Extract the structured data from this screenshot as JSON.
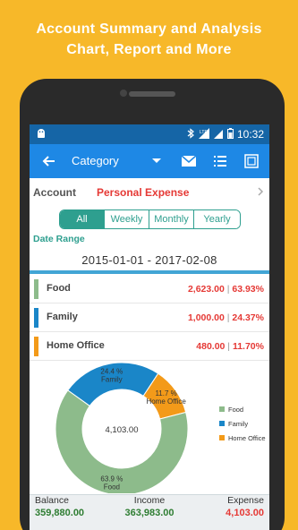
{
  "promo": {
    "line1": "Account Summary and Analysis",
    "line2": "Chart, Report and More"
  },
  "status_bar": {
    "time": "10:32",
    "icons": [
      "android-icon",
      "bluetooth-icon",
      "lte-icon",
      "signal-icon",
      "battery-icon"
    ]
  },
  "toolbar": {
    "title": "Category",
    "actions": [
      "mail-icon",
      "list-icon",
      "screenshot-icon"
    ]
  },
  "account": {
    "label": "Account",
    "value": "Personal Expense"
  },
  "period_tabs": {
    "options": [
      "All",
      "Weekly",
      "Monthly",
      "Yearly"
    ],
    "selected": "All"
  },
  "date_range": {
    "label": "Date Range",
    "value": "2015-01-01 - 2017-02-08"
  },
  "categories": [
    {
      "name": "Food",
      "amount": "2,623.00",
      "percent": "63.93%",
      "color": "#8DBB8B"
    },
    {
      "name": "Family",
      "amount": "1,000.00",
      "percent": "24.37%",
      "color": "#1A86C8"
    },
    {
      "name": "Home Office",
      "amount": "480.00",
      "percent": "11.70%",
      "color": "#F39A19"
    }
  ],
  "chart_data": {
    "type": "pie",
    "style": "donut",
    "center_label": "4,103.00",
    "categories": [
      "Food",
      "Family",
      "Home Office"
    ],
    "values": [
      63.9,
      24.4,
      11.7
    ],
    "slice_labels": [
      "63.9 %\nFood",
      "24.4 %\nFamily",
      "11.7 %\nHome Office"
    ],
    "colors": [
      "#8DBB8B",
      "#1A86C8",
      "#F39A19"
    ],
    "legend_position": "right"
  },
  "summary": {
    "balance_label": "Balance",
    "balance": "359,880.00",
    "income_label": "Income",
    "income": "363,983.00",
    "expense_label": "Expense",
    "expense": "4,103.00",
    "positive_color": "#2E7D32",
    "negative_color": "#E53935"
  }
}
